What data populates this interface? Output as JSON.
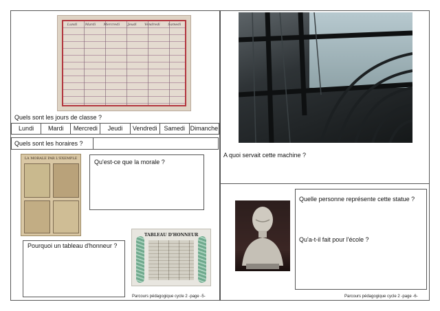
{
  "left_page": {
    "timetable_photo": {
      "header_words": [
        "Lundi",
        "Mardi",
        "Mercredi",
        "Jeudi",
        "Vendredi",
        "Samedi"
      ]
    },
    "q_days": "Quels sont les jours de classe ?",
    "days": [
      "Lundi",
      "Mardi",
      "Mercredi",
      "Jeudi",
      "Vendredi",
      "Samedi",
      "Dimanche"
    ],
    "q_hours": "Quels sont les horaires ?",
    "morale_poster": {
      "title": "LA MORALE PAR L'EXEMPLE"
    },
    "q_morale": "Qu'est-ce que la morale ?",
    "q_honneur": "Pourquoi un tableau d'honneur ?",
    "honneur_photo": {
      "title": "TABLEAU D'HONNEUR"
    },
    "footer": "Parcours pédagogique cycle 2 -page -5-"
  },
  "right_page": {
    "q_machine": "A quoi servait cette machine ?",
    "q_statue": "Quelle personne représente cette statue ?",
    "q_school": "Qu'a-t-il fait pour l'école ?",
    "footer": "Parcours pédagogique cycle 2 -page -6-"
  }
}
